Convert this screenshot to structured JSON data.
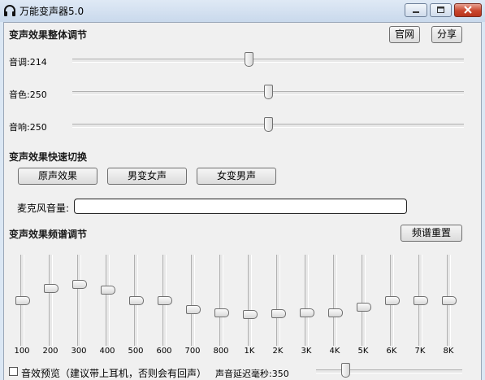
{
  "window": {
    "title": "万能变声器5.0",
    "controls": [
      "minimize",
      "maximize",
      "close"
    ]
  },
  "overall": {
    "section_title": "变声效果整体调节",
    "website_button": "官网",
    "share_button": "分享",
    "sliders": [
      {
        "label": "音调",
        "value": "214",
        "level": 0.45
      },
      {
        "label": "音色",
        "value": "250",
        "level": 0.5
      },
      {
        "label": "音响",
        "value": "250",
        "level": 0.5
      }
    ]
  },
  "quick_switch": {
    "section_title": "变声效果快速切换",
    "buttons": [
      "原声效果",
      "男变女声",
      "女变男声"
    ]
  },
  "mic": {
    "label": "麦克风音量:",
    "level": 0
  },
  "spectrum": {
    "section_title": "变声效果频谱调节",
    "reset_button": "频谱重置",
    "bands": [
      {
        "freq": "100",
        "level": 0.5
      },
      {
        "freq": "200",
        "level": 0.63
      },
      {
        "freq": "300",
        "level": 0.68
      },
      {
        "freq": "400",
        "level": 0.62
      },
      {
        "freq": "500",
        "level": 0.5
      },
      {
        "freq": "600",
        "level": 0.5
      },
      {
        "freq": "700",
        "level": 0.4
      },
      {
        "freq": "800",
        "level": 0.37
      },
      {
        "freq": "1K",
        "level": 0.35
      },
      {
        "freq": "2K",
        "level": 0.36
      },
      {
        "freq": "3K",
        "level": 0.37
      },
      {
        "freq": "4K",
        "level": 0.37
      },
      {
        "freq": "5K",
        "level": 0.43
      },
      {
        "freq": "6K",
        "level": 0.5
      },
      {
        "freq": "7K",
        "level": 0.5
      },
      {
        "freq": "8K",
        "level": 0.5
      }
    ]
  },
  "footer": {
    "preview_label": "音效预览（建议带上耳机，否则会有回声）",
    "preview_checked": false,
    "delay_label": "声音延迟毫秒:",
    "delay_value": "350",
    "delay_level": 0.2
  },
  "colors": {
    "window_frame": "#dbe7f4",
    "client_bg": "#f0f0f0",
    "close_button": "#c9452c"
  }
}
